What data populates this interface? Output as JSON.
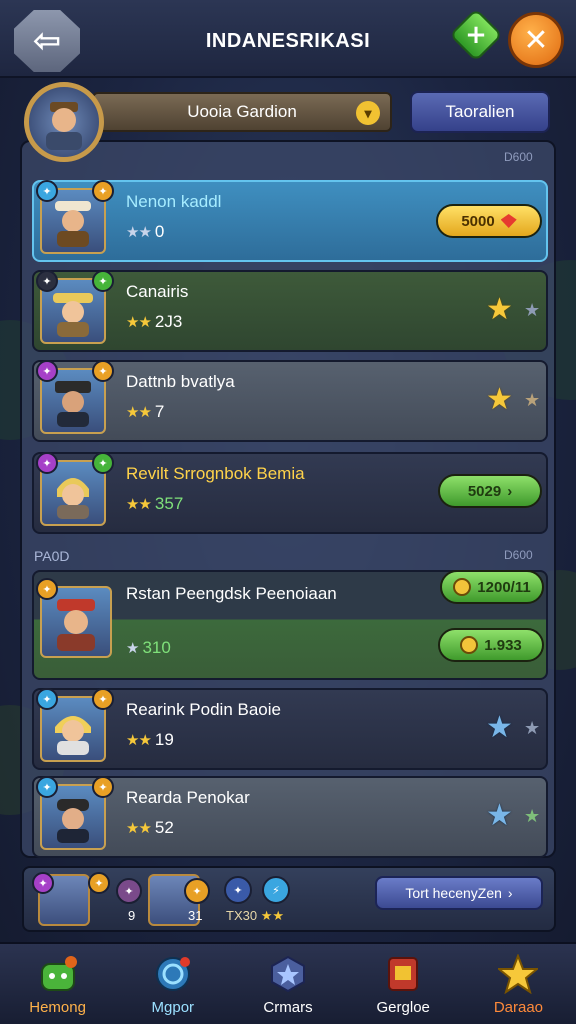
{
  "header": {
    "title": "INDANESRIKASI",
    "back_icon": "back-arrow-icon",
    "add_icon": "plus-icon",
    "close_icon": "close-icon"
  },
  "profile": {
    "name": "Uooia Gardion",
    "tab_label": "Taoralien"
  },
  "sections": {
    "top_tag": "D600",
    "mid_left_tag": "PA0D",
    "mid_right_tag": "D600"
  },
  "rows": [
    {
      "name": "Nenon kaddl",
      "stat": "0",
      "stars": "★★",
      "price": "5000",
      "style": "blue"
    },
    {
      "name": "Canairis",
      "stat": "2J3",
      "stars": "★★",
      "style": "green"
    },
    {
      "name": "Dattnb bvatlya",
      "stat": "7",
      "stars": "★★",
      "style": "grey"
    },
    {
      "name": "Revilt Srrognbok Bemia",
      "stat": "357",
      "stars": "★★",
      "price": "5029",
      "style": "dark"
    },
    {
      "name": "Rstan Peengdsk Peenoiaan",
      "stat": "310",
      "stars": "★",
      "price": "1200/11",
      "price2": "1.933",
      "style": "big"
    },
    {
      "name": "Rearink Podin Baoie",
      "stat": "19",
      "stars": "★★",
      "style": "dark"
    },
    {
      "name": "Rearda Penokar",
      "stat": "52",
      "stars": "★★",
      "style": "grey"
    }
  ],
  "strip": {
    "num1": "9",
    "num2": "31",
    "num3": "TX30",
    "num3_stars": "★★",
    "button": "Tort hecenyZen"
  },
  "nav": [
    {
      "label": "Hemong",
      "icon": "home-icon"
    },
    {
      "label": "Mgpor",
      "icon": "map-icon"
    },
    {
      "label": "Crmars",
      "icon": "star-badge-icon"
    },
    {
      "label": "Gergloe",
      "icon": "shop-icon"
    },
    {
      "label": "Daraao",
      "icon": "star-icon"
    }
  ],
  "colors": {
    "accent_orange": "#ffb24a",
    "gold": "#f6c83a",
    "blue_row": "#3f8fc0",
    "green_pill": "#8ee06a"
  }
}
